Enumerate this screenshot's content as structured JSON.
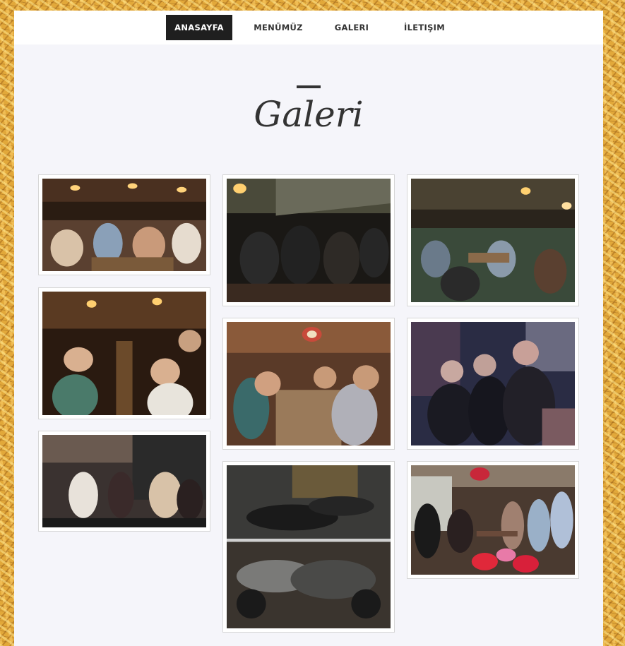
{
  "nav": {
    "items": [
      {
        "label": "ANASAYFA",
        "active": true
      },
      {
        "label": "MENÜMÜZ",
        "active": false
      },
      {
        "label": "GALERI",
        "active": false
      },
      {
        "label": "İLETIŞIM",
        "active": false
      }
    ]
  },
  "gallery": {
    "title": "Galeri",
    "photos": [
      {
        "subject": "crowded pub tables at night"
      },
      {
        "subject": "biker club members gathered indoors"
      },
      {
        "subject": "open-air terrace crowd at tables"
      },
      {
        "subject": "group selfie at long table"
      },
      {
        "subject": "friends around wooden table with dartboard"
      },
      {
        "subject": "three men posing in bar"
      },
      {
        "subject": "group of women seated in cafe"
      },
      {
        "subject": "motorcycles parked at night"
      },
      {
        "subject": "birthday group with red balloons"
      }
    ]
  },
  "colors": {
    "nav_active_bg": "#1f1f1f",
    "page_bg": "#f5f5fa",
    "frame_border": "#d6d6d6"
  }
}
